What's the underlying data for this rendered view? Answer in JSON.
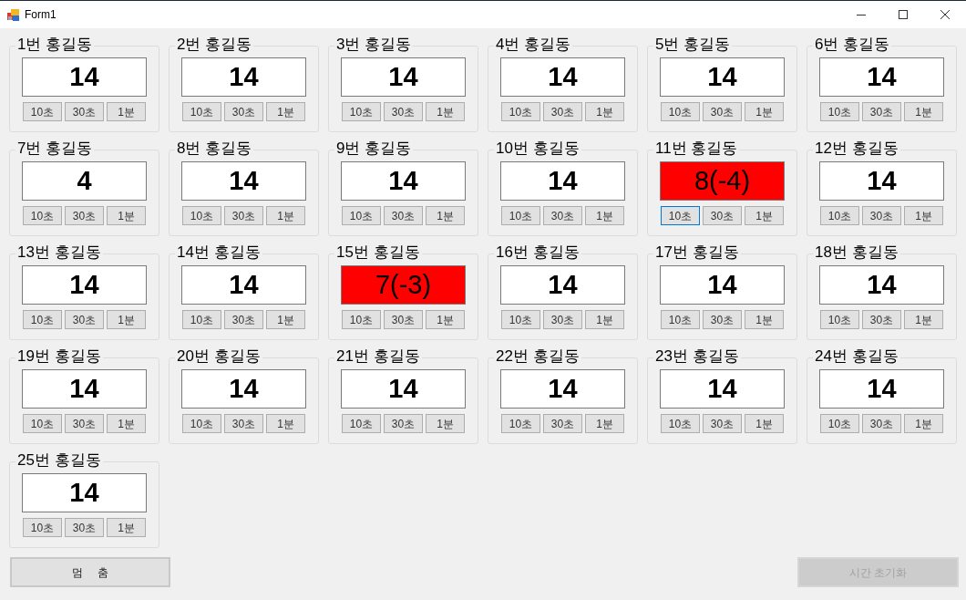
{
  "window": {
    "title": "Form1"
  },
  "groups": [
    {
      "title": "1번 홍길동",
      "value": "14",
      "alert": false,
      "buttons": [
        {
          "label": "10초",
          "focused": false
        },
        {
          "label": "30초",
          "focused": false
        },
        {
          "label": "1분",
          "focused": false
        }
      ]
    },
    {
      "title": "2번 홍길동",
      "value": "14",
      "alert": false,
      "buttons": [
        {
          "label": "10초",
          "focused": false
        },
        {
          "label": "30초",
          "focused": false
        },
        {
          "label": "1분",
          "focused": false
        }
      ]
    },
    {
      "title": "3번 홍길동",
      "value": "14",
      "alert": false,
      "buttons": [
        {
          "label": "10초",
          "focused": false
        },
        {
          "label": "30초",
          "focused": false
        },
        {
          "label": "1분",
          "focused": false
        }
      ]
    },
    {
      "title": "4번 홍길동",
      "value": "14",
      "alert": false,
      "buttons": [
        {
          "label": "10초",
          "focused": false
        },
        {
          "label": "30초",
          "focused": false
        },
        {
          "label": "1분",
          "focused": false
        }
      ]
    },
    {
      "title": "5번 홍길동",
      "value": "14",
      "alert": false,
      "buttons": [
        {
          "label": "10초",
          "focused": false
        },
        {
          "label": "30초",
          "focused": false
        },
        {
          "label": "1분",
          "focused": false
        }
      ]
    },
    {
      "title": "6번 홍길동",
      "value": "14",
      "alert": false,
      "buttons": [
        {
          "label": "10초",
          "focused": false
        },
        {
          "label": "30초",
          "focused": false
        },
        {
          "label": "1분",
          "focused": false
        }
      ]
    },
    {
      "title": "7번 홍길동",
      "value": "4",
      "alert": false,
      "buttons": [
        {
          "label": "10초",
          "focused": false
        },
        {
          "label": "30초",
          "focused": false
        },
        {
          "label": "1분",
          "focused": false
        }
      ]
    },
    {
      "title": "8번 홍길동",
      "value": "14",
      "alert": false,
      "buttons": [
        {
          "label": "10초",
          "focused": false
        },
        {
          "label": "30초",
          "focused": false
        },
        {
          "label": "1분",
          "focused": false
        }
      ]
    },
    {
      "title": "9번 홍길동",
      "value": "14",
      "alert": false,
      "buttons": [
        {
          "label": "10초",
          "focused": false
        },
        {
          "label": "30초",
          "focused": false
        },
        {
          "label": "1분",
          "focused": false
        }
      ]
    },
    {
      "title": "10번 홍길동",
      "value": "14",
      "alert": false,
      "buttons": [
        {
          "label": "10초",
          "focused": false
        },
        {
          "label": "30초",
          "focused": false
        },
        {
          "label": "1분",
          "focused": false
        }
      ]
    },
    {
      "title": "11번 홍길동",
      "value": "8(-4)",
      "alert": true,
      "buttons": [
        {
          "label": "10초",
          "focused": true
        },
        {
          "label": "30초",
          "focused": false
        },
        {
          "label": "1분",
          "focused": false
        }
      ]
    },
    {
      "title": "12번 홍길동",
      "value": "14",
      "alert": false,
      "buttons": [
        {
          "label": "10초",
          "focused": false
        },
        {
          "label": "30초",
          "focused": false
        },
        {
          "label": "1분",
          "focused": false
        }
      ]
    },
    {
      "title": "13번 홍길동",
      "value": "14",
      "alert": false,
      "buttons": [
        {
          "label": "10초",
          "focused": false
        },
        {
          "label": "30초",
          "focused": false
        },
        {
          "label": "1분",
          "focused": false
        }
      ]
    },
    {
      "title": "14번 홍길동",
      "value": "14",
      "alert": false,
      "buttons": [
        {
          "label": "10초",
          "focused": false
        },
        {
          "label": "30초",
          "focused": false
        },
        {
          "label": "1분",
          "focused": false
        }
      ]
    },
    {
      "title": "15번 홍길동",
      "value": "7(-3)",
      "alert": true,
      "buttons": [
        {
          "label": "10초",
          "focused": false
        },
        {
          "label": "30초",
          "focused": false
        },
        {
          "label": "1분",
          "focused": false
        }
      ]
    },
    {
      "title": "16번 홍길동",
      "value": "14",
      "alert": false,
      "buttons": [
        {
          "label": "10초",
          "focused": false
        },
        {
          "label": "30초",
          "focused": false
        },
        {
          "label": "1분",
          "focused": false
        }
      ]
    },
    {
      "title": "17번 홍길동",
      "value": "14",
      "alert": false,
      "buttons": [
        {
          "label": "10초",
          "focused": false
        },
        {
          "label": "30초",
          "focused": false
        },
        {
          "label": "1분",
          "focused": false
        }
      ]
    },
    {
      "title": "18번 홍길동",
      "value": "14",
      "alert": false,
      "buttons": [
        {
          "label": "10초",
          "focused": false
        },
        {
          "label": "30초",
          "focused": false
        },
        {
          "label": "1분",
          "focused": false
        }
      ]
    },
    {
      "title": "19번 홍길동",
      "value": "14",
      "alert": false,
      "buttons": [
        {
          "label": "10초",
          "focused": false
        },
        {
          "label": "30초",
          "focused": false
        },
        {
          "label": "1분",
          "focused": false
        }
      ]
    },
    {
      "title": "20번 홍길동",
      "value": "14",
      "alert": false,
      "buttons": [
        {
          "label": "10초",
          "focused": false
        },
        {
          "label": "30초",
          "focused": false
        },
        {
          "label": "1분",
          "focused": false
        }
      ]
    },
    {
      "title": "21번 홍길동",
      "value": "14",
      "alert": false,
      "buttons": [
        {
          "label": "10초",
          "focused": false
        },
        {
          "label": "30초",
          "focused": false
        },
        {
          "label": "1분",
          "focused": false
        }
      ]
    },
    {
      "title": "22번 홍길동",
      "value": "14",
      "alert": false,
      "buttons": [
        {
          "label": "10초",
          "focused": false
        },
        {
          "label": "30초",
          "focused": false
        },
        {
          "label": "1분",
          "focused": false
        }
      ]
    },
    {
      "title": "23번 홍길동",
      "value": "14",
      "alert": false,
      "buttons": [
        {
          "label": "10초",
          "focused": false
        },
        {
          "label": "30초",
          "focused": false
        },
        {
          "label": "1분",
          "focused": false
        }
      ]
    },
    {
      "title": "24번 홍길동",
      "value": "14",
      "alert": false,
      "buttons": [
        {
          "label": "10초",
          "focused": false
        },
        {
          "label": "30초",
          "focused": false
        },
        {
          "label": "1분",
          "focused": false
        }
      ]
    },
    {
      "title": "25번 홍길동",
      "value": "14",
      "alert": false,
      "buttons": [
        {
          "label": "10초",
          "focused": false
        },
        {
          "label": "30초",
          "focused": false
        },
        {
          "label": "1분",
          "focused": false
        }
      ]
    }
  ],
  "stop_button": {
    "label": "멈     춤",
    "disabled": false
  },
  "reset_button": {
    "label": "시간 초기화",
    "disabled": true
  }
}
